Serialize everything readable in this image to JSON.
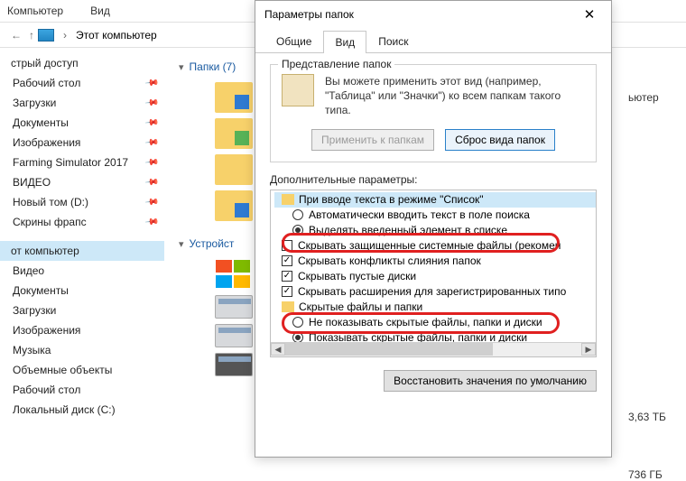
{
  "toolbar": {
    "item1": "Компьютер",
    "item2": "Вид"
  },
  "addressbar": {
    "location": "Этот компьютер"
  },
  "sidebar": {
    "pinned": [
      {
        "label": "стрый доступ"
      },
      {
        "label": "Рабочий стол"
      },
      {
        "label": "Загрузки"
      },
      {
        "label": "Документы"
      },
      {
        "label": "Изображения"
      },
      {
        "label": "Farming Simulator 2017"
      },
      {
        "label": "ВИДЕО"
      },
      {
        "label": "Новый том (D:)"
      },
      {
        "label": "Скрины фрапс"
      }
    ],
    "computer_header": "от компьютер",
    "computer_items": [
      {
        "label": "Видео"
      },
      {
        "label": "Документы"
      },
      {
        "label": "Загрузки"
      },
      {
        "label": "Изображения"
      },
      {
        "label": "Музыка"
      },
      {
        "label": "Объемные объекты"
      },
      {
        "label": "Рабочий стол"
      },
      {
        "label": "Локальный диск (C:)"
      }
    ]
  },
  "sections": {
    "folders": "Папки (7)",
    "devices": "Устройст"
  },
  "right": {
    "partial": "ьютер",
    "size1": "3,63 ТБ",
    "size2": "736 ГБ"
  },
  "dialog": {
    "title": "Параметры папок",
    "tabs": {
      "general": "Общие",
      "view": "Вид",
      "search": "Поиск"
    },
    "group1": {
      "legend": "Представление папок",
      "desc": "Вы можете применить этот вид (например, \"Таблица\" или \"Значки\") ко всем папкам такого типа.",
      "apply_btn": "Применить к папкам",
      "reset_btn": "Сброс вида папок"
    },
    "adv_label": "Дополнительные параметры:",
    "tree": {
      "r0": "При вводе текста в режиме \"Список\"",
      "r1": "Автоматически вводить текст в поле поиска",
      "r2": "Выделять введенный элемент в списке",
      "r3": "Скрывать защищенные системные файлы (рекомен",
      "r4": "Скрывать конфликты слияния папок",
      "r5": "Скрывать пустые диски",
      "r6": "Скрывать расширения для зарегистрированных типо",
      "r7": "Скрытые файлы и папки",
      "r8": "Не показывать скрытые файлы, папки и диски",
      "r9": "Показывать скрытые файлы, папки и диски"
    },
    "restore_btn": "Восстановить значения по умолчанию"
  }
}
